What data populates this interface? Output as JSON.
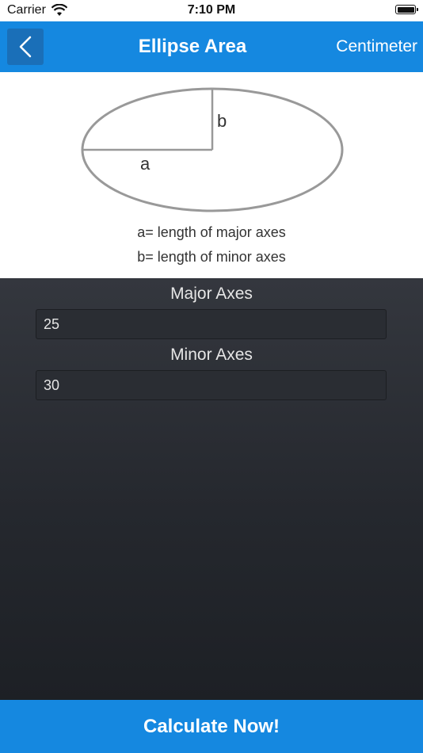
{
  "status_bar": {
    "carrier": "Carrier",
    "time": "7:10 PM"
  },
  "navbar": {
    "back_icon": "chevron-left-icon",
    "title": "Ellipse Area",
    "unit": "Centimeter",
    "background_color": "#1588e0"
  },
  "diagram": {
    "label_a": "a",
    "label_b": "b",
    "legend_a": "a= length of major axes",
    "legend_b": "b= length of minor axes"
  },
  "form": {
    "major_label": "Major Axes",
    "major_value": "25",
    "minor_label": "Minor Axes",
    "minor_value": "30"
  },
  "calculate_button": {
    "label": "Calculate Now!",
    "color": "#1588e0"
  }
}
